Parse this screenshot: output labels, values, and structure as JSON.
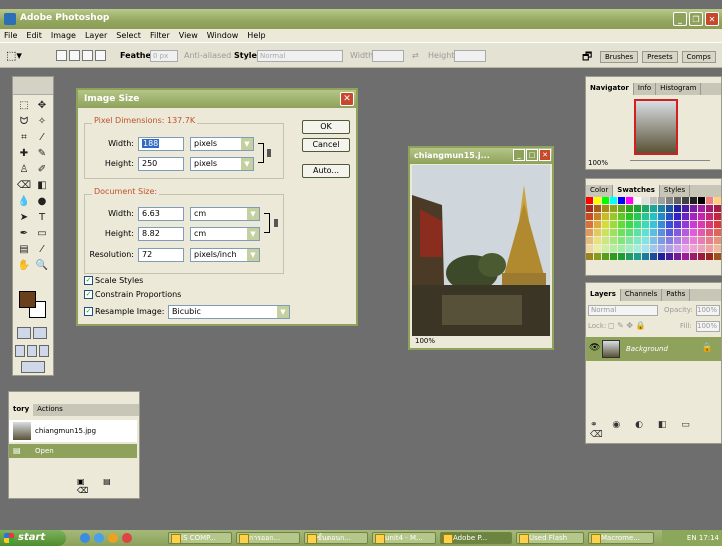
{
  "colors": {
    "title_bar": "#93a65e",
    "workspace": "#6e6e6e",
    "dialog_face": "#ece9d8",
    "group_title": "#c0522c",
    "foreground_swatch": "#6b3f1c",
    "background_swatch": "#ffffff"
  },
  "window": {
    "title": "Adobe Photoshop"
  },
  "menu": [
    "File",
    "Edit",
    "Image",
    "Layer",
    "Select",
    "Filter",
    "View",
    "Window",
    "Help"
  ],
  "options_bar": {
    "feather_label": "Feather:",
    "feather_value": "0 px",
    "antialiased_label": "Anti-aliased",
    "style_label": "Style:",
    "style_value": "Normal",
    "width_label": "Width:",
    "height_label": "Height:",
    "palette_tabs": [
      "Brushes",
      "Presets",
      "Comps"
    ]
  },
  "dialog": {
    "title": "Image Size",
    "pixel_dimensions_label": "Pixel Dimensions:",
    "pixel_dimensions_size": "137.7K",
    "px_width_label": "Width:",
    "px_width_value": "188",
    "px_width_unit": "pixels",
    "px_height_label": "Height:",
    "px_height_value": "250",
    "px_height_unit": "pixels",
    "document_size_label": "Document Size:",
    "doc_width_label": "Width:",
    "doc_width_value": "6.63",
    "doc_width_unit": "cm",
    "doc_height_label": "Height:",
    "doc_height_value": "8.82",
    "doc_height_unit": "cm",
    "resolution_label": "Resolution:",
    "resolution_value": "72",
    "resolution_unit": "pixels/inch",
    "scale_styles_label": "Scale Styles",
    "scale_styles_checked": true,
    "constrain_label": "Constrain Proportions",
    "constrain_checked": true,
    "resample_label": "Resample Image:",
    "resample_checked": true,
    "resample_method": "Bicubic",
    "ok_label": "OK",
    "cancel_label": "Cancel",
    "auto_label": "Auto..."
  },
  "document_window": {
    "title": "chiangmun15.j...",
    "zoom": "100%"
  },
  "navigator_palette": {
    "tabs": [
      "Navigator",
      "Info",
      "Histogram"
    ],
    "zoom": "100%"
  },
  "swatches_palette": {
    "tabs": [
      "Color",
      "Swatches",
      "Styles"
    ]
  },
  "layers_palette": {
    "tabs": [
      "Layers",
      "Channels",
      "Paths"
    ],
    "blend_mode": "Normal",
    "opacity_label": "Opacity:",
    "opacity_value": "100%",
    "lock_label": "Lock:",
    "fill_label": "Fill:",
    "fill_value": "100%",
    "layer_name": "Background"
  },
  "history_palette": {
    "tabs": [
      "tory",
      "Actions"
    ],
    "snapshot": "chiangmun15.jpg",
    "state": "Open"
  },
  "taskbar": {
    "start_label": "start",
    "tasks": [
      {
        "label": "IS COMP..."
      },
      {
        "label": "การออก..."
      },
      {
        "label": "ขั้นตอนก..."
      },
      {
        "label": "unit4 - M..."
      },
      {
        "label": "Adobe P..."
      },
      {
        "label": "Used Flash"
      },
      {
        "label": "Macrome..."
      }
    ],
    "lang": "EN",
    "clock": "17:14"
  }
}
